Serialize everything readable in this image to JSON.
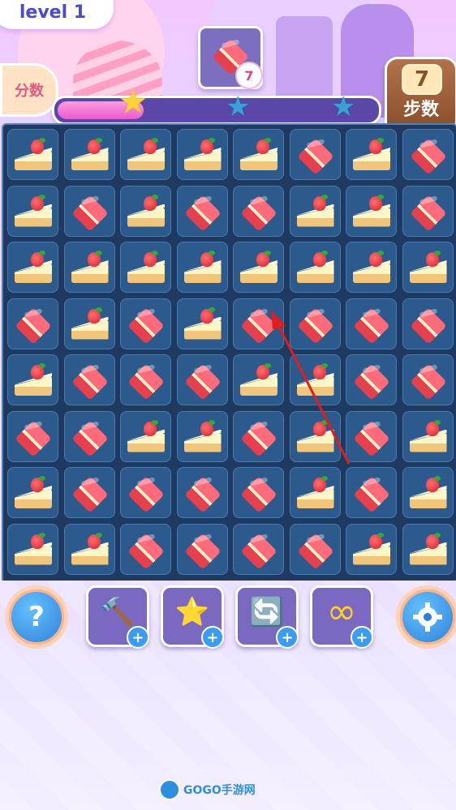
{
  "header": {
    "level_label": "level 1",
    "score_label": "分数",
    "moves": {
      "value": "7",
      "label": "步数"
    }
  },
  "target": {
    "item_icon": "red-square-cake-icon",
    "count": "7"
  },
  "progress": {
    "fill_fraction": 0.27,
    "stars": [
      "gold",
      "blue",
      "blue"
    ]
  },
  "board": {
    "rows": 8,
    "cols": 8,
    "tiles": [
      [
        "cake",
        "cake",
        "cake",
        "cake",
        "cake",
        "square",
        "cake",
        "square"
      ],
      [
        "cake",
        "square",
        "cake",
        "square",
        "square",
        "cake",
        "cake",
        "square"
      ],
      [
        "cake",
        "cake",
        "cake",
        "cake",
        "cake",
        "cake",
        "cake",
        "cake"
      ],
      [
        "square",
        "cake",
        "square",
        "cake",
        "square",
        "square",
        "square",
        "square"
      ],
      [
        "cake",
        "square",
        "square",
        "square",
        "cake",
        "cake",
        "square",
        "square"
      ],
      [
        "square",
        "square",
        "cake",
        "cake",
        "square",
        "cake",
        "square",
        "cake"
      ],
      [
        "cake",
        "square",
        "square",
        "square",
        "square",
        "cake",
        "square",
        "cake"
      ],
      [
        "cake",
        "cake",
        "square",
        "square",
        "square",
        "square",
        "cake",
        "cake"
      ]
    ]
  },
  "tools": [
    {
      "name": "hammer",
      "icon": "hammer-icon",
      "glyph": "🔨"
    },
    {
      "name": "magic-wand",
      "icon": "star-wand-icon",
      "glyph": "⭐"
    },
    {
      "name": "shuffle",
      "icon": "refresh-icon",
      "glyph": "🔄"
    },
    {
      "name": "infinite-moves",
      "icon": "infinity-icon",
      "glyph": "∞"
    }
  ],
  "buttons": {
    "help": "?",
    "settings_icon": "gear-icon",
    "plus": "+"
  },
  "watermark": {
    "text": "GOGO手游网"
  }
}
